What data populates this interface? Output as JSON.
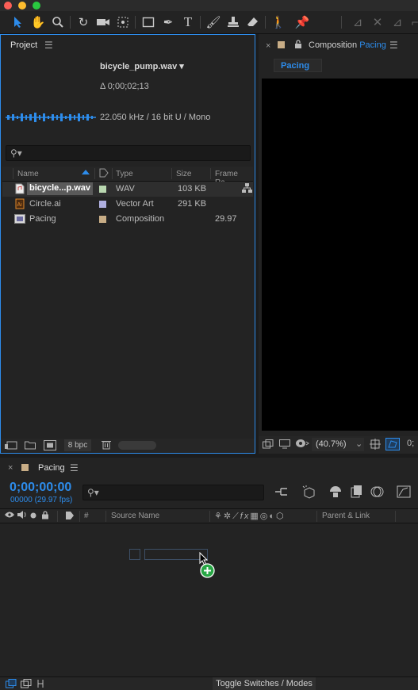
{
  "project": {
    "tab_label": "Project",
    "file_name": "bicycle_pump.wav ▾",
    "duration": "Δ 0;00;02;13",
    "audio_info": "22.050 kHz / 16 bit U / Mono",
    "search_placeholder": "",
    "columns": {
      "name": "Name",
      "type": "Type",
      "size": "Size",
      "frame_rate": "Frame Ra..."
    },
    "items": [
      {
        "name": "bicycle...p.wav",
        "type": "WAV",
        "size": "103 KB",
        "frame_rate": "",
        "color": "#b9d7b0",
        "icon": "audio-file-icon"
      },
      {
        "name": "Circle.ai",
        "type": "Vector Art",
        "size": "291 KB",
        "frame_rate": "",
        "color": "#b0b0e0",
        "icon": "illustrator-file-icon"
      },
      {
        "name": "Pacing",
        "type": "Composition",
        "size": "",
        "frame_rate": "29.97",
        "color": "#c8ad86",
        "icon": "composition-icon"
      }
    ],
    "bpc_label": "8 bpc"
  },
  "composition": {
    "label": "Composition",
    "name": "Pacing",
    "tab": "Pacing",
    "zoom": "(40.7%)",
    "partial_value": "0;"
  },
  "timeline": {
    "tab_label": "Pacing",
    "timecode": "0;00;00;00",
    "frame_info": "00000 (29.97 fps)",
    "search_placeholder": "",
    "hash_label": "#",
    "source_name_label": "Source Name",
    "parent_link_label": "Parent & Link",
    "toggle_label": "Toggle Switches / Modes"
  },
  "colors": {
    "accent": "#2d8ceb",
    "pacing_swatch": "#c8ad86",
    "add_badge": "#28a745"
  }
}
